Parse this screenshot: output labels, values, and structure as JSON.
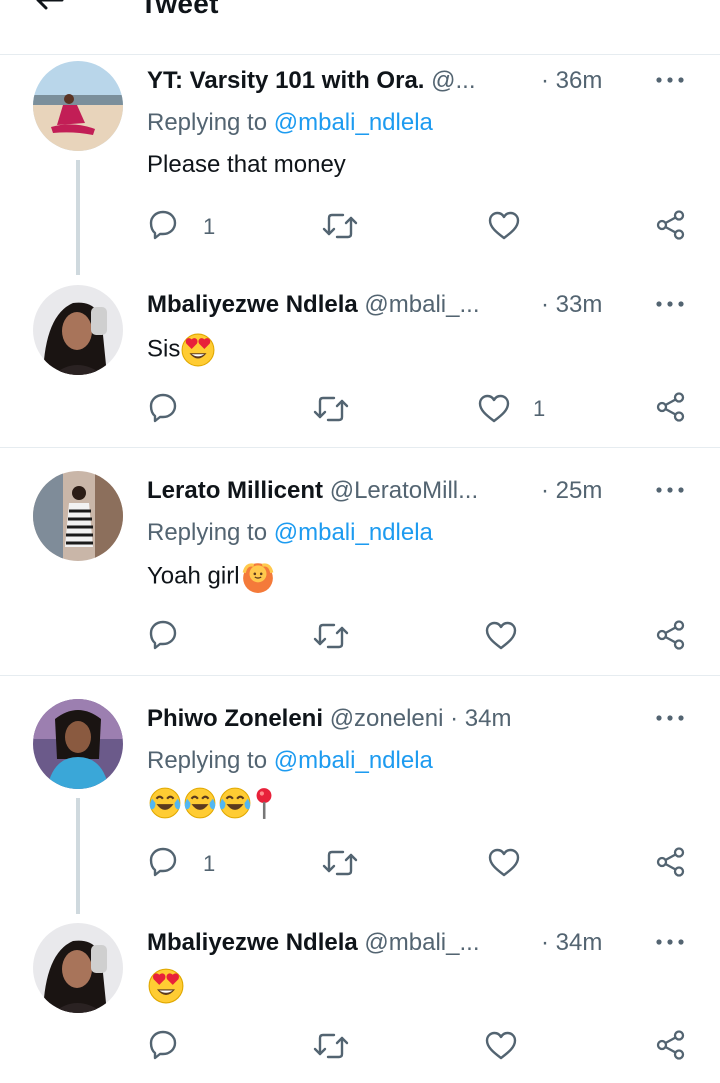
{
  "header": {
    "title": "Tweet"
  },
  "tweets": [
    {
      "name": "YT: Varsity 101 with Ora.",
      "handle": "@...",
      "time": "· 36m",
      "replying_prefix": "Replying to ",
      "replying_to": "@mbali_ndlela",
      "text": "Please that money",
      "reply_count": "1",
      "like_count": "",
      "avatar_colors": {
        "bg": "#e9d9c4",
        "accent": "#c21e56"
      }
    },
    {
      "name": "Mbaliyezwe Ndlela",
      "handle": "@mbali_...",
      "time": "· 33m",
      "text": "Sis",
      "emojis": [
        "smiling-face-heart-eyes"
      ],
      "reply_count": "",
      "like_count": "1"
    },
    {
      "name": "Lerato Millicent",
      "handle": "@LeratoMill...",
      "time": "· 25m",
      "replying_prefix": "Replying to ",
      "replying_to": "@mbali_ndlela",
      "text": "Yoah girl",
      "emojis": [
        "person-gesturing-ok"
      ]
    },
    {
      "name": "Phiwo Zoneleni",
      "handle": "@zoneleni",
      "time": "· 34m",
      "replying_prefix": "Replying to ",
      "replying_to": "@mbali_ndlela",
      "text": "",
      "emojis": [
        "face-with-tears-of-joy",
        "face-with-tears-of-joy",
        "face-with-tears-of-joy",
        "round-pushpin"
      ],
      "reply_count": "1"
    },
    {
      "name": "Mbaliyezwe Ndlela",
      "handle": "@mbali_...",
      "time": "· 34m",
      "text": "",
      "emojis": [
        "smiling-face-heart-eyes"
      ]
    }
  ],
  "colors": {
    "link": "#1d9bf0",
    "secondary": "#536471",
    "divider": "#e6ecf0"
  },
  "icons": [
    "back-arrow-icon",
    "more-icon",
    "reply-icon",
    "retweet-icon",
    "like-icon",
    "share-icon"
  ]
}
